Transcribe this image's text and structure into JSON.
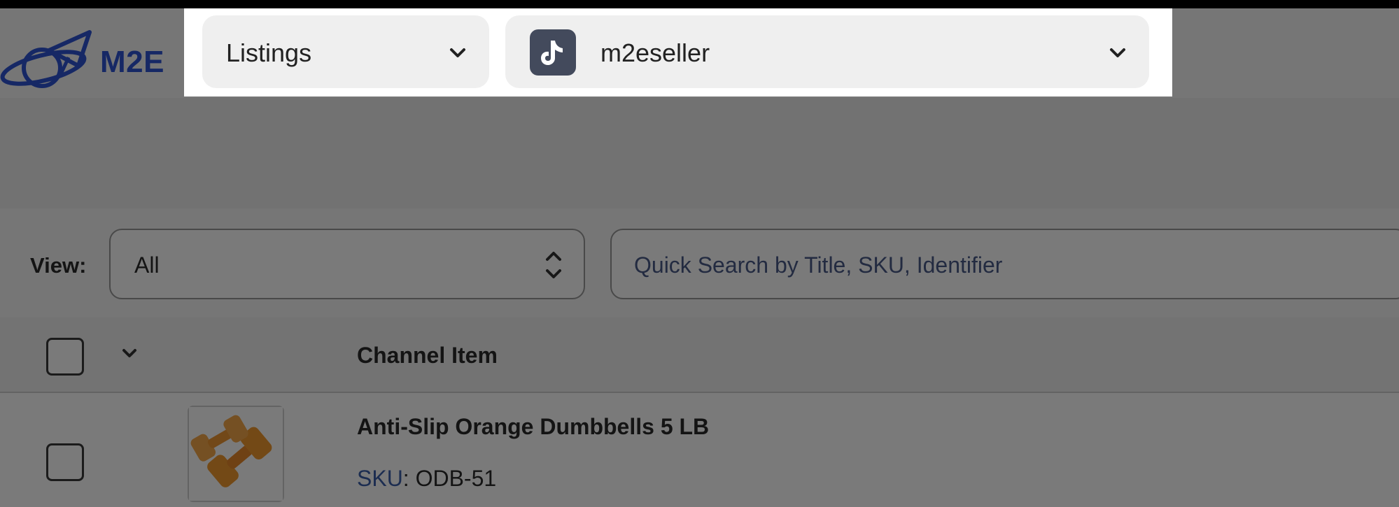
{
  "app": {
    "logo_text": "M2E"
  },
  "header": {
    "module_selector": {
      "value": "Listings"
    },
    "account_selector": {
      "value": "m2eseller",
      "icon": "tiktok-icon"
    }
  },
  "filters": {
    "view_label": "View:",
    "view_value": "All",
    "search_placeholder": "Quick Search by Title, SKU, Identifier"
  },
  "table": {
    "columns": [
      "Channel Item"
    ],
    "rows": [
      {
        "title": "Anti-Slip Orange Dumbbells 5 LB",
        "sku_label": "SKU",
        "sku_value": "ODB-51"
      }
    ]
  },
  "colors": {
    "brand_blue": "#2f55d4",
    "sku_label": "#3c5fa9",
    "tiktok_tile": "#434a5c",
    "dim_overlay": "rgba(0,0,0,0.52)"
  }
}
